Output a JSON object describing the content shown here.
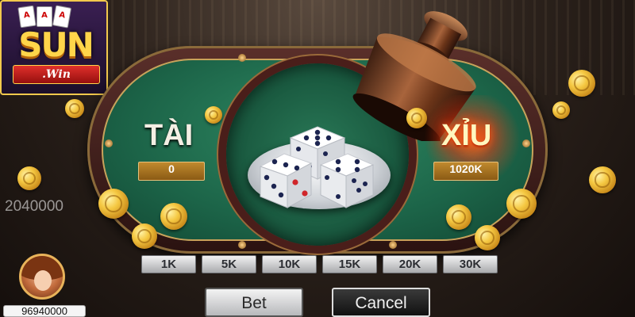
{
  "logo": {
    "brand": "SUN",
    "ribbon": ".Win",
    "cards": [
      "A",
      "A",
      "A"
    ]
  },
  "table": {
    "tai": {
      "label": "TÀI",
      "amount": "0"
    },
    "xiu": {
      "label": "XỈU",
      "amount": "1020K"
    },
    "dice": [
      5,
      3,
      4
    ]
  },
  "pot_total": "2040000",
  "chips": [
    "1K",
    "5K",
    "10K",
    "15K",
    "20K",
    "30K"
  ],
  "actions": {
    "bet": "Bet",
    "cancel": "Cancel"
  },
  "player": {
    "balance": "96940000"
  },
  "colors": {
    "felt": "#1c6448",
    "rim": "#5a2f2a",
    "gold": "#f5c842",
    "xiu_glow": "#ff5a1a"
  }
}
